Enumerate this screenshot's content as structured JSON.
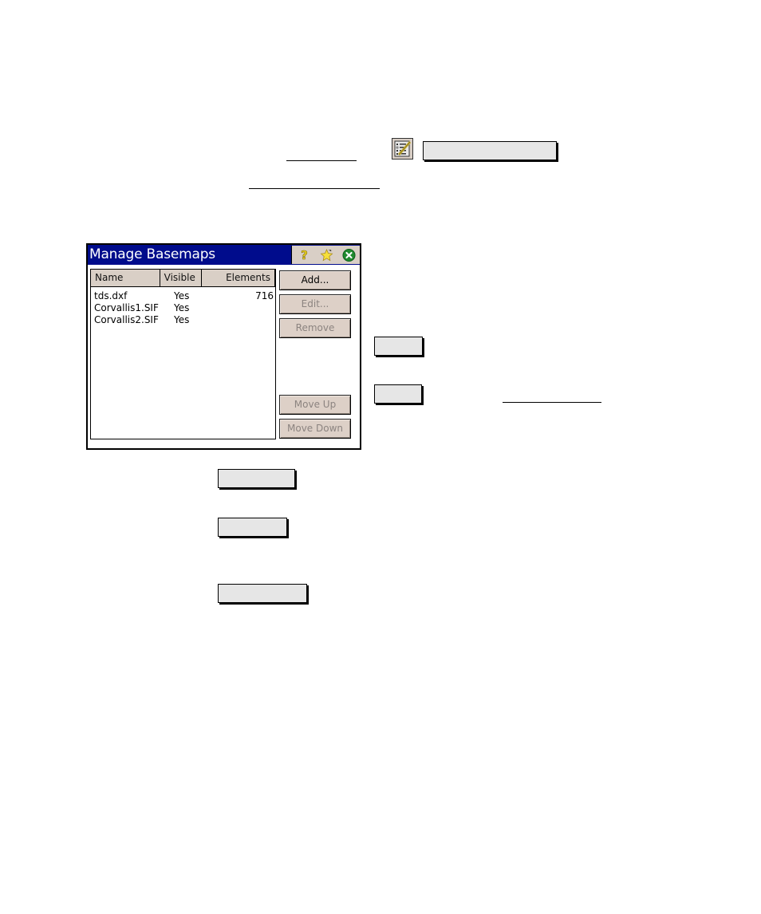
{
  "doc": {
    "inline_icon": "basemap-list-icon",
    "inline_buttons": [
      {
        "name": "toolbar-button",
        "label": ""
      },
      {
        "name": "ref-button-a",
        "label": ""
      },
      {
        "name": "ref-button-b",
        "label": ""
      },
      {
        "name": "ref-button-c",
        "label": ""
      },
      {
        "name": "ref-button-d",
        "label": ""
      },
      {
        "name": "ref-button-e",
        "label": ""
      }
    ]
  },
  "dialog": {
    "title": "Manage Basemaps",
    "title_icons": {
      "help": "?",
      "favorite": "★",
      "close": "✕"
    },
    "columns": [
      "Name",
      "Visible",
      "Elements"
    ],
    "rows": [
      {
        "name": "tds.dxf",
        "visible": "Yes",
        "elements": "716"
      },
      {
        "name": "Corvallis1.SIF",
        "visible": "Yes",
        "elements": ""
      },
      {
        "name": "Corvallis2.SIF",
        "visible": "Yes",
        "elements": ""
      }
    ],
    "buttons": {
      "add": "Add...",
      "edit": "Edit...",
      "remove": "Remove",
      "move_up": "Move Up",
      "move_down": "Move Down"
    },
    "colors": {
      "titlebar": "#000c8c",
      "button_face": "#ddd0c7",
      "disabled_text": "#8c8480"
    }
  }
}
